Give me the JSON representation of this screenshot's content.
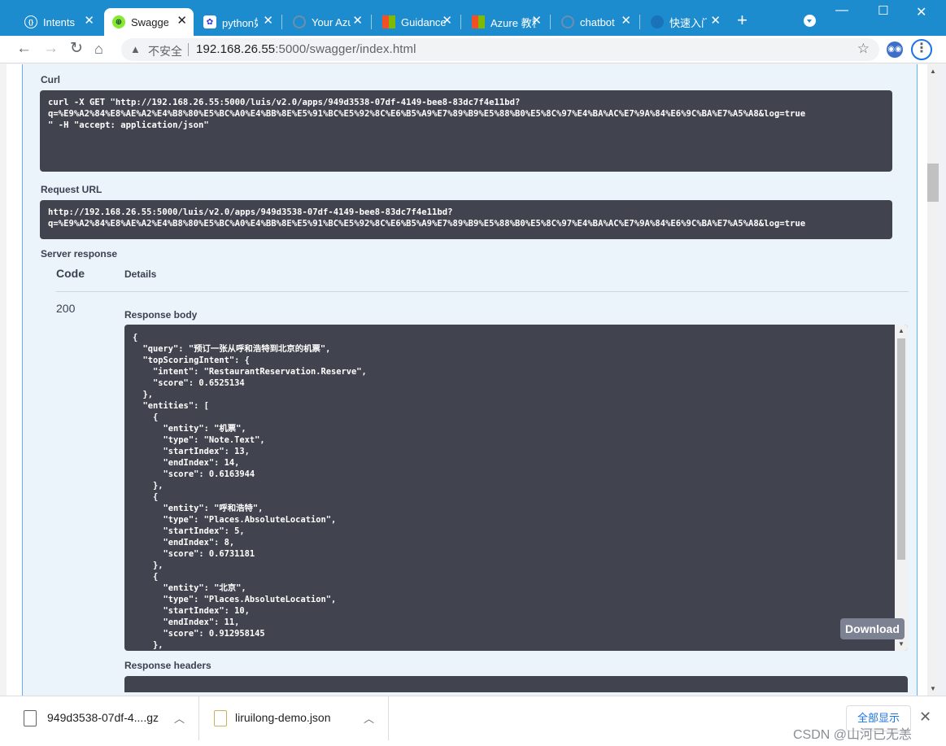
{
  "tabs": [
    {
      "label": "Intents",
      "icon": "code-braces-icon"
    },
    {
      "label": "Swagger UI",
      "icon": "swagger-icon"
    },
    {
      "label": "python如何",
      "icon": "baidu-paw-icon"
    },
    {
      "label": "Your Azure",
      "icon": "globe-icon"
    },
    {
      "label": "Guidance",
      "icon": "microsoft-icon"
    },
    {
      "label": "Azure 教程",
      "icon": "microsoft-icon"
    },
    {
      "label": "chatbot",
      "icon": "globe-icon"
    },
    {
      "label": "快速入门",
      "icon": "cloud-icon"
    }
  ],
  "tab_close": "✕",
  "new_tab": "+",
  "window_controls": {
    "minimize": "—",
    "maximize": "☐",
    "close": "✕"
  },
  "address": {
    "warning": "▲",
    "insecure": "不安全",
    "host": "192.168.26.55",
    "path": ":5000/swagger/index.html"
  },
  "sections": {
    "curl_label": "Curl",
    "request_url_label": "Request URL",
    "server_response_label": "Server response",
    "code_header": "Code",
    "details_header": "Details",
    "response_body_label": "Response body",
    "response_headers_label": "Response headers",
    "download_button": "Download"
  },
  "curl": "curl -X GET \"http://192.168.26.55:5000/luis/v2.0/apps/949d3538-07df-4149-bee8-83dc7f4e11bd?\nq=%E9%A2%84%E8%AE%A2%E4%B8%80%E5%BC%A0%E4%BB%8E%E5%91%BC%E5%92%8C%E6%B5%A9%E7%89%B9%E5%88%B0%E5%8C%97%E4%BA%AC%E7%9A%84%E6%9C%BA%E7%A5%A8&log=true\n\" -H \"accept: application/json\"",
  "request_url": "http://192.168.26.55:5000/luis/v2.0/apps/949d3538-07df-4149-bee8-83dc7f4e11bd?\nq=%E9%A2%84%E8%AE%A2%E4%B8%80%E5%BC%A0%E4%BB%8E%E5%91%BC%E5%92%8C%E6%B5%A9%E7%89%B9%E5%88%B0%E5%8C%97%E4%BA%AC%E7%9A%84%E6%9C%BA%E7%A5%A8&log=true",
  "status_code": "200",
  "response_body": "{\n  \"query\": \"预订一张从呼和浩特到北京的机票\",\n  \"topScoringIntent\": {\n    \"intent\": \"RestaurantReservation.Reserve\",\n    \"score\": 0.6525134\n  },\n  \"entities\": [\n    {\n      \"entity\": \"机票\",\n      \"type\": \"Note.Text\",\n      \"startIndex\": 13,\n      \"endIndex\": 14,\n      \"score\": 0.6163944\n    },\n    {\n      \"entity\": \"呼和浩特\",\n      \"type\": \"Places.AbsoluteLocation\",\n      \"startIndex\": 5,\n      \"endIndex\": 8,\n      \"score\": 0.6731181\n    },\n    {\n      \"entity\": \"北京\",\n      \"type\": \"Places.AbsoluteLocation\",\n      \"startIndex\": 10,\n      \"endIndex\": 11,\n      \"score\": 0.912958145\n    },",
  "downloads": [
    {
      "name": "949d3538-07df-4....gz",
      "icon": "archive-file-icon"
    },
    {
      "name": "liruilong-demo.json",
      "icon": "json-file-icon"
    }
  ],
  "show_all": "全部显示",
  "watermark": "CSDN @山河已无恙"
}
